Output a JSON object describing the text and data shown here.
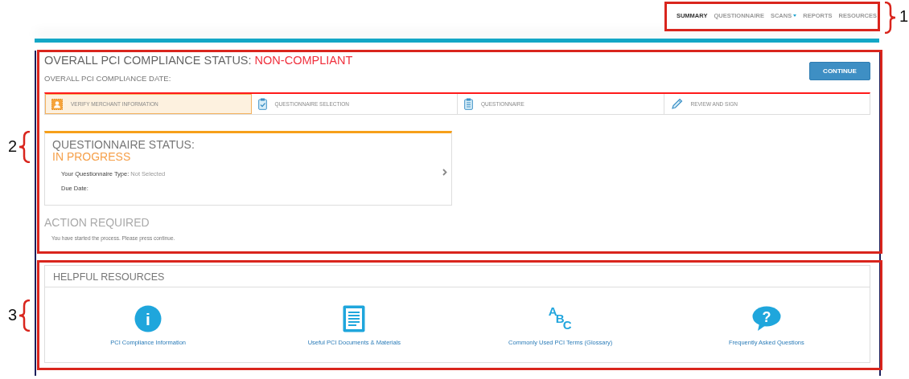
{
  "nav": {
    "items": [
      {
        "label": "SUMMARY",
        "selected": true,
        "has_menu": false
      },
      {
        "label": "QUESTIONNAIRE",
        "selected": false,
        "has_menu": false
      },
      {
        "label": "SCANS",
        "selected": false,
        "has_menu": true
      },
      {
        "label": "REPORTS",
        "selected": false,
        "has_menu": false
      },
      {
        "label": "RESOURCES",
        "selected": false,
        "has_menu": false
      }
    ]
  },
  "status": {
    "title": "OVERALL PCI COMPLIANCE STATUS:",
    "value": "NON-COMPLIANT",
    "date_label": "OVERALL PCI COMPLIANCE DATE:",
    "button": "CONTINUE"
  },
  "steps": [
    {
      "label": "VERIFY MERCHANT INFORMATION",
      "kind": "person",
      "selected": true
    },
    {
      "label": "QUESTIONNAIRE SELECTION",
      "kind": "clipboard-check",
      "selected": false
    },
    {
      "label": "QUESTIONNAIRE",
      "kind": "clipboard",
      "selected": false
    },
    {
      "label": "REVIEW AND SIGN",
      "kind": "pencil",
      "selected": false
    }
  ],
  "questionnaire_card": {
    "title": "QUESTIONNAIRE STATUS:",
    "status": "IN PROGRESS",
    "fields": [
      {
        "label": "Your Questionnaire Type:",
        "value": "Not Selected"
      },
      {
        "label": "Due Date:"
      }
    ]
  },
  "action": {
    "title": "ACTION REQUIRED",
    "message": "You have started the process. Please press continue."
  },
  "resources": {
    "title": "HELPFUL RESOURCES",
    "items": [
      {
        "label": "PCI Compliance Information",
        "kind": "info",
        "glyph": "i"
      },
      {
        "label": "Useful PCI Documents & Materials",
        "kind": "document"
      },
      {
        "label": "Commonly Used PCI Terms (Glossary)",
        "kind": "letters",
        "letters": [
          "A",
          "B",
          "C"
        ]
      },
      {
        "label": "Frequently Asked Questions",
        "kind": "speech",
        "glyph": "?"
      }
    ]
  },
  "annotations": [
    {
      "label": "1"
    },
    {
      "label": "2"
    },
    {
      "label": "3"
    }
  ]
}
